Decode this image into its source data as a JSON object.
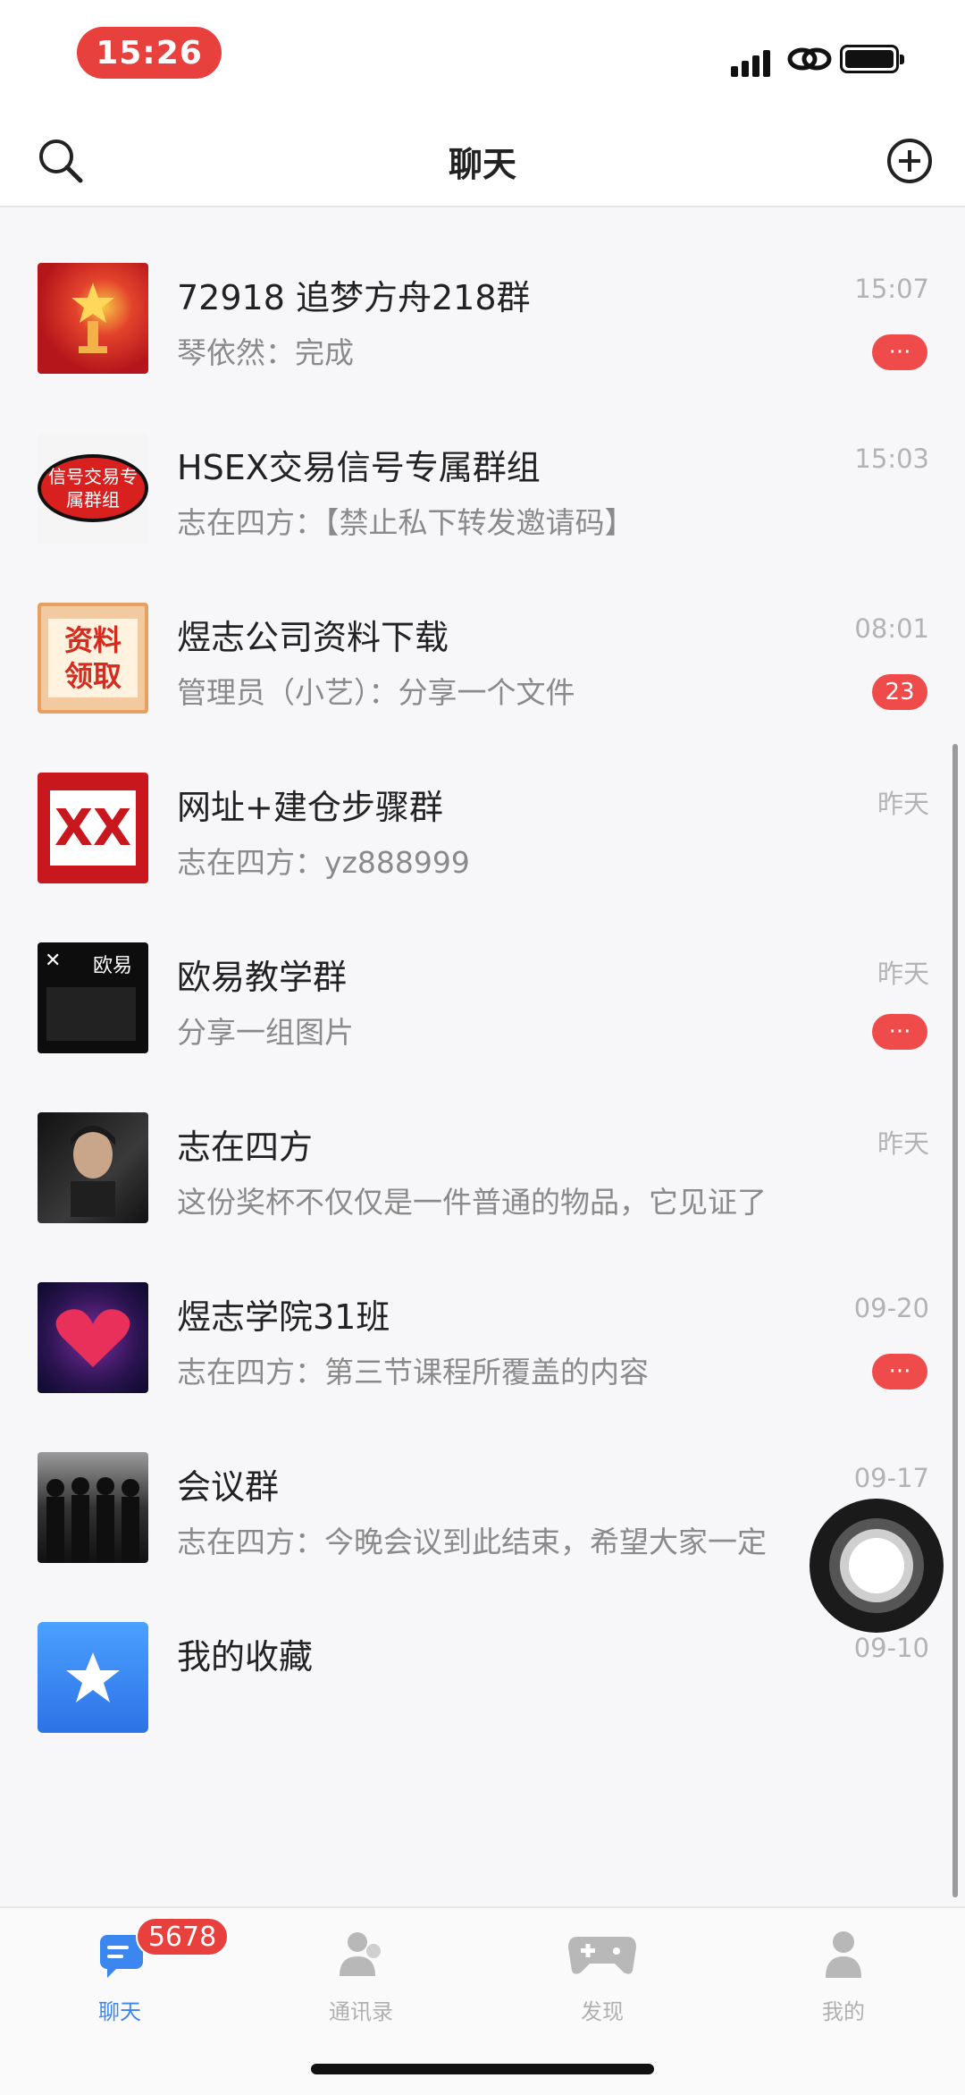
{
  "status_bar": {
    "time": "15:26"
  },
  "nav": {
    "title": "聊天"
  },
  "chats": [
    {
      "name": "72918 追梦方舟218群",
      "preview": "琴依然：完成",
      "time": "15:07",
      "badge": "···"
    },
    {
      "name": "HSEX交易信号专属群组",
      "preview": "志在四方：【禁止私下转发邀请码】",
      "time": "15:03",
      "badge": "",
      "avatar_text": "信号交易专属群组"
    },
    {
      "name": "煜志公司资料下载",
      "preview": "管理员（小艺）：分享一个文件",
      "time": "08:01",
      "badge": "23",
      "avatar_text": "资料领取"
    },
    {
      "name": "网址+建仓步骤群",
      "preview": "志在四方：yz888999",
      "time": "昨天",
      "badge": "",
      "avatar_text": "XX"
    },
    {
      "name": "欧易教学群",
      "preview": "分享一组图片",
      "time": "昨天",
      "badge": "···",
      "avatar_text": "欧易"
    },
    {
      "name": "志在四方",
      "preview": "这份奖杯不仅仅是一件普通的物品，它见证了",
      "time": "昨天",
      "badge": ""
    },
    {
      "name": "煜志学院31班",
      "preview": "志在四方：第三节课程所覆盖的内容",
      "time": "09-20",
      "badge": "···"
    },
    {
      "name": "会议群",
      "preview": "志在四方：今晚会议到此结束，希望大家一定",
      "time": "09-17",
      "badge": ""
    },
    {
      "name": "我的收藏",
      "preview": "",
      "time": "09-10",
      "badge": ""
    }
  ],
  "tabs": [
    {
      "label": "聊天",
      "active": true,
      "badge": "5678"
    },
    {
      "label": "通讯录",
      "active": false
    },
    {
      "label": "发现",
      "active": false
    },
    {
      "label": "我的",
      "active": false
    }
  ],
  "colors": {
    "accent": "#3c86f0",
    "badge_red": "#ef4b4b",
    "time_pill": "#e8413d"
  }
}
